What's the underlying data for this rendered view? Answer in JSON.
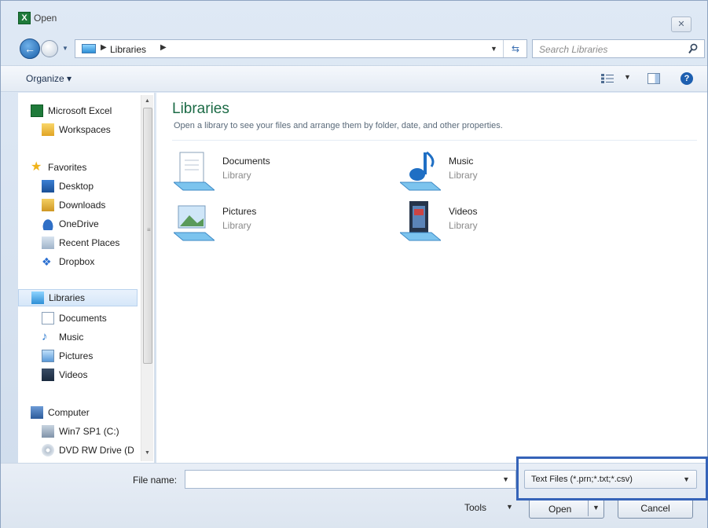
{
  "window": {
    "title": "Open",
    "close_label": "✕"
  },
  "address": {
    "path_root": "Libraries",
    "search_placeholder": "Search Libraries"
  },
  "toolbar": {
    "organize_label": "Organize ▾"
  },
  "nav": {
    "items": [
      {
        "label": "Microsoft Excel",
        "icon": "excel-icon"
      },
      {
        "label": "Workspaces",
        "icon": "workspaces-icon"
      },
      {
        "label": "Favorites",
        "icon": "star-icon"
      },
      {
        "label": "Desktop",
        "icon": "desktop-icon"
      },
      {
        "label": "Downloads",
        "icon": "downloads-icon"
      },
      {
        "label": "OneDrive",
        "icon": "onedrive-icon"
      },
      {
        "label": "Recent Places",
        "icon": "recent-places-icon"
      },
      {
        "label": "Dropbox",
        "icon": "dropbox-icon"
      },
      {
        "label": "Libraries",
        "icon": "libraries-icon",
        "selected": true
      },
      {
        "label": "Documents",
        "icon": "documents-icon"
      },
      {
        "label": "Music",
        "icon": "music-icon"
      },
      {
        "label": "Pictures",
        "icon": "pictures-icon"
      },
      {
        "label": "Videos",
        "icon": "videos-icon"
      },
      {
        "label": "Computer",
        "icon": "computer-icon"
      },
      {
        "label": "Win7 SP1 (C:)",
        "icon": "drive-icon"
      },
      {
        "label": "DVD RW Drive (D",
        "icon": "dvd-drive-icon"
      }
    ]
  },
  "content": {
    "title": "Libraries",
    "description": "Open a library to see your files and arrange them by folder, date, and other properties.",
    "libraries": [
      {
        "name": "Documents",
        "type": "Library",
        "icon": "documents-library-icon"
      },
      {
        "name": "Music",
        "type": "Library",
        "icon": "music-library-icon"
      },
      {
        "name": "Pictures",
        "type": "Library",
        "icon": "pictures-library-icon"
      },
      {
        "name": "Videos",
        "type": "Library",
        "icon": "videos-library-icon"
      }
    ]
  },
  "footer": {
    "file_name_label": "File name:",
    "file_name_value": "",
    "file_type_value": "Text Files (*.prn;*.txt;*.csv)",
    "tools_label": "Tools",
    "open_label": "Open",
    "cancel_label": "Cancel"
  },
  "colors": {
    "highlight": "#3563b8",
    "library_title": "#1c6b46"
  }
}
